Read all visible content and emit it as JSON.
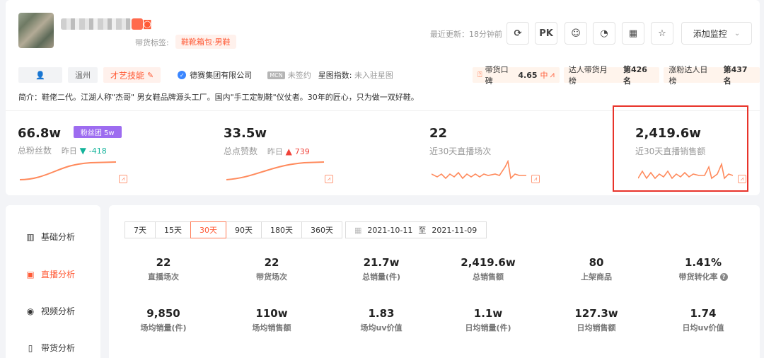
{
  "profile": {
    "live_icon": "直播",
    "tag_label": "带货标签:",
    "tag_value": "鞋靴箱包·男鞋",
    "update_text": "最近更新：18分钟前",
    "pk_label": "PK",
    "monitor_label": "添加监控",
    "location": "温州",
    "talent_label": "才艺技能",
    "org_name": "德赛集团有限公司",
    "mcn_badge": "MCN",
    "mcn_status": "未签约",
    "star_label": "星图指数:",
    "star_value": "未入驻星图",
    "intro": "简介：鞋佬二代。江湖人称\"杰哥\" 男女鞋品牌源头工厂。国内\"手工定制鞋\"仪仗者。30年的匠心，只为做一双好鞋。"
  },
  "ranks": [
    {
      "label": "带货口碑",
      "value": "4.65",
      "level": "中"
    },
    {
      "label": "达人带货月榜",
      "value": "第426名"
    },
    {
      "label": "涨粉达人日榜",
      "value": "第437名"
    }
  ],
  "stats": {
    "fans": {
      "value": "66.8w",
      "badge": "粉丝团 5w",
      "label": "总粉丝数",
      "yday_label": "昨日",
      "yday_value": "-418"
    },
    "likes": {
      "value": "33.5w",
      "label": "总点赞数",
      "yday_label": "昨日",
      "yday_value": "739"
    },
    "lives": {
      "value": "22",
      "label": "近30天直播场次"
    },
    "sales": {
      "value": "2,419.6w",
      "label": "近30天直播销售额"
    }
  },
  "sidebar": {
    "items": [
      {
        "label": "基础分析"
      },
      {
        "label": "直播分析"
      },
      {
        "label": "视频分析"
      },
      {
        "label": "带货分析"
      }
    ]
  },
  "ranges": [
    "7天",
    "15天",
    "30天",
    "90天",
    "180天",
    "360天"
  ],
  "active_range": "30天",
  "date": {
    "start": "2021-10-11",
    "sep": "至",
    "end": "2021-11-09"
  },
  "metrics": [
    {
      "value": "22",
      "label": "直播场次"
    },
    {
      "value": "22",
      "label": "带货场次"
    },
    {
      "value": "21.7w",
      "label": "总销量(件)"
    },
    {
      "value": "2,419.6w",
      "label": "总销售额"
    },
    {
      "value": "80",
      "label": "上架商品"
    },
    {
      "value": "1.41%",
      "label": "带货转化率"
    },
    {
      "value": "9,850",
      "label": "场均销量(件)"
    },
    {
      "value": "110w",
      "label": "场均销售额"
    },
    {
      "value": "1.83",
      "label": "场均uv价值"
    },
    {
      "value": "1.1w",
      "label": "日均销量(件)"
    },
    {
      "value": "127.3w",
      "label": "日均销售额"
    },
    {
      "value": "1.74",
      "label": "日均uv价值"
    }
  ],
  "colors": {
    "accent": "#ff5a36",
    "highlight": "#e8332a",
    "fans_badge": "#9d6cf0"
  }
}
